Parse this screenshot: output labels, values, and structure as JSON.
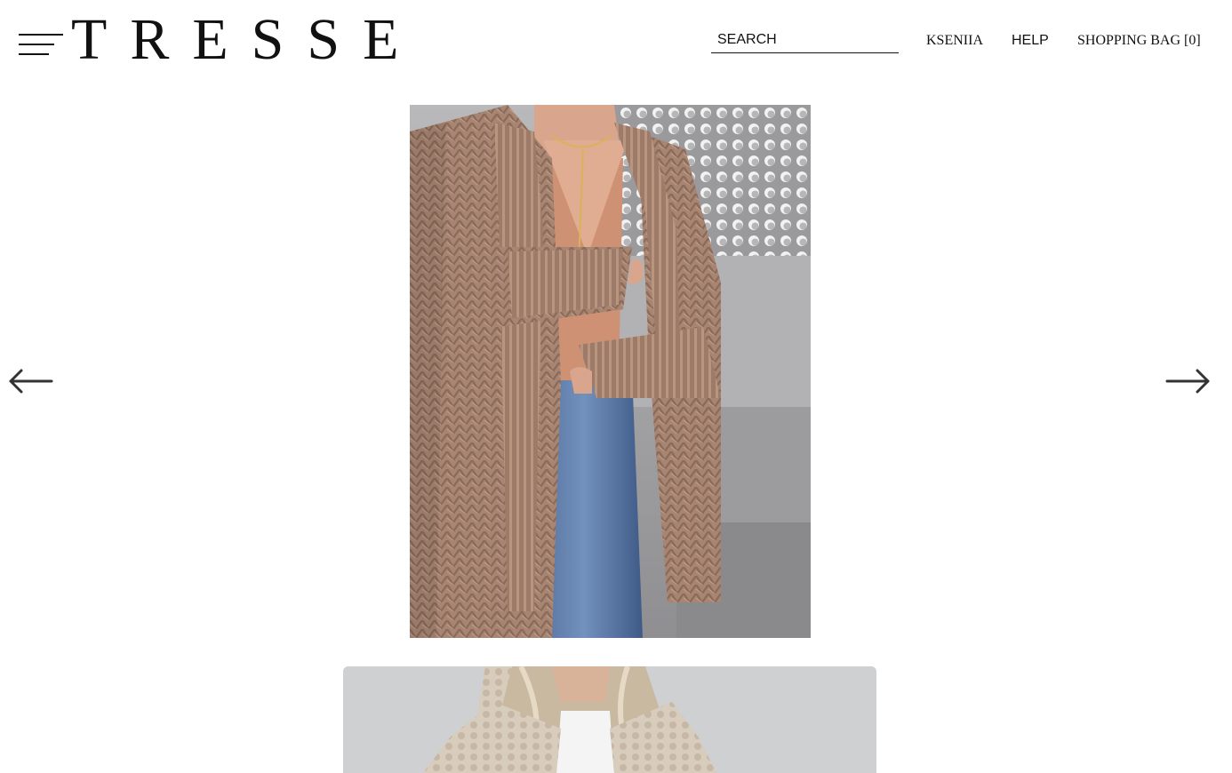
{
  "header": {
    "logo": "TRESSE",
    "search_placeholder": "SEARCH",
    "search_value": "",
    "user_label": "KSENIIA",
    "help_label": "HELP",
    "bag_label": "SHOPPING BAG [0]"
  },
  "icons": {
    "menu": "hamburger-menu-icon",
    "prev": "arrow-left-icon",
    "next": "arrow-right-icon"
  },
  "colors": {
    "text": "#111111",
    "background": "#ffffff"
  }
}
